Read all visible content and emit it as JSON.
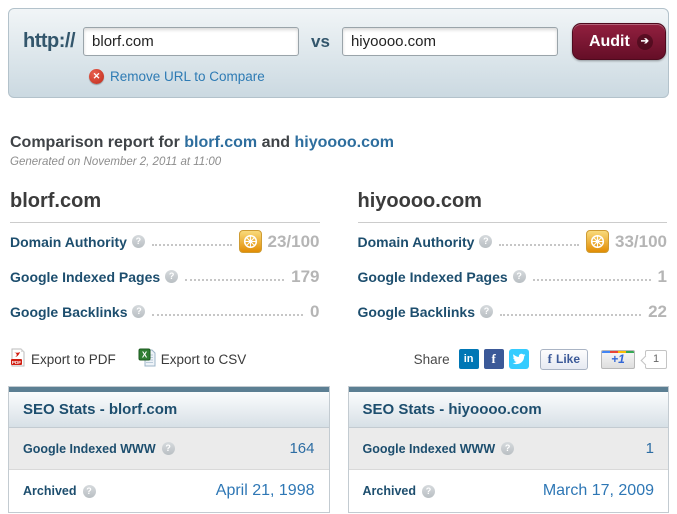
{
  "audit_bar": {
    "protocol_label": "http://",
    "url1_value": "blorf.com",
    "vs_label": "vs",
    "url2_value": "hiyoooo.com",
    "audit_button_label": "Audit",
    "audit_arrow_glyph": "➔",
    "remove_icon_glyph": "✕",
    "remove_link_label": "Remove URL to Compare"
  },
  "report": {
    "title_prefix": "Comparison report for ",
    "domain1": "blorf.com",
    "title_and": " and ",
    "domain2": "hiyoooo.com",
    "generated_line": "Generated on November 2, 2011 at 11:00"
  },
  "help_glyph": "?",
  "columns": [
    {
      "title": "blorf.com",
      "stats": [
        {
          "label": "Domain Authority",
          "value": "23/100"
        },
        {
          "label": "Google Indexed Pages",
          "value": "179"
        },
        {
          "label": "Google Backlinks",
          "value": "0"
        }
      ]
    },
    {
      "title": "hiyoooo.com",
      "stats": [
        {
          "label": "Domain Authority",
          "value": "33/100"
        },
        {
          "label": "Google Indexed Pages",
          "value": "1"
        },
        {
          "label": "Google Backlinks",
          "value": "22"
        }
      ]
    }
  ],
  "export_share": {
    "export_pdf_label": "Export to PDF",
    "export_csv_label": "Export to CSV",
    "share_label": "Share",
    "linkedin_glyph": "in",
    "facebook_glyph": "f",
    "like_f_glyph": "f",
    "like_label": "Like",
    "plus_one_label": "+1",
    "plus_one_count": "1"
  },
  "seo_panels": [
    {
      "title": "SEO Stats - blorf.com",
      "rows": [
        {
          "label": "Google Indexed WWW",
          "value": "164"
        },
        {
          "label": "Archived",
          "value": "April 21, 1998"
        }
      ]
    },
    {
      "title": "SEO Stats - hiyoooo.com",
      "rows": [
        {
          "label": "Google Indexed WWW",
          "value": "1"
        },
        {
          "label": "Archived",
          "value": "March 17, 2009"
        }
      ]
    }
  ],
  "colors": {
    "accent_blue_link": "#2e7bb4",
    "navy_label": "#1d4e6e",
    "maroon_button": "#650e27",
    "value_gray": "#b5b5b5",
    "moz_badge_gold": "#e28d04",
    "panel_strip": "#5c7f93"
  }
}
